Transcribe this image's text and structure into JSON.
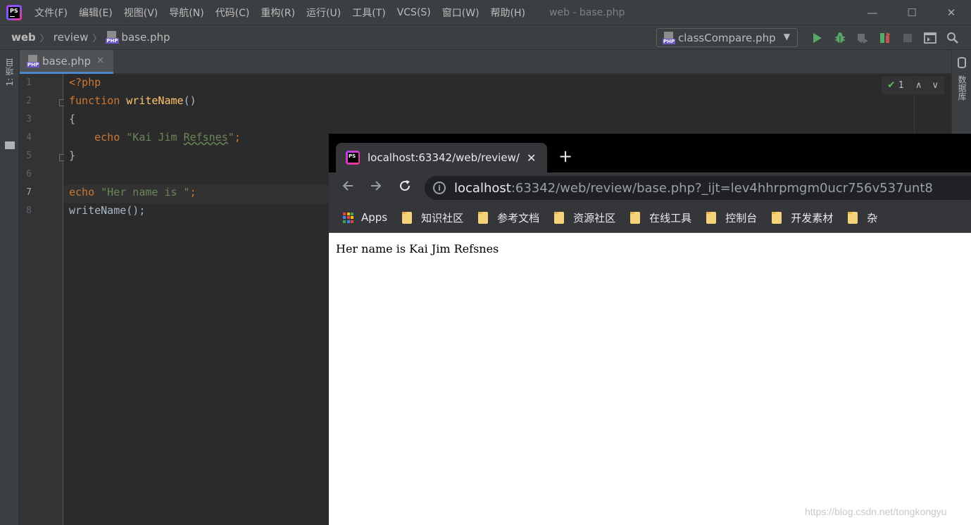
{
  "menubar": {
    "logo": "PS",
    "items": [
      "文件(F)",
      "编辑(E)",
      "视图(V)",
      "导航(N)",
      "代码(C)",
      "重构(R)",
      "运行(U)",
      "工具(T)",
      "VCS(S)",
      "窗口(W)",
      "帮助(H)"
    ],
    "window_title": "web - base.php",
    "controls": [
      "—",
      "☐",
      "✕"
    ]
  },
  "navbar": {
    "crumbs": [
      "web",
      "review",
      "base.php"
    ],
    "file_icon_label": "PHP",
    "run_config": "classCompare.php",
    "icons": [
      "play-icon",
      "debug-icon",
      "coverage-icon",
      "profiler-icon",
      "stop-icon",
      "terminal-icon",
      "search-icon"
    ],
    "colors": {
      "run": "#59a869",
      "bug": "#59a869"
    }
  },
  "left_strip": {
    "label": "1: 项目"
  },
  "right_strip": {
    "label": "数据库"
  },
  "tab": {
    "label": "base.php",
    "close": "✕"
  },
  "editor": {
    "line_numbers": [
      "1",
      "2",
      "3",
      "4",
      "5",
      "6",
      "7",
      "8"
    ],
    "current_line": "7",
    "lines": [
      {
        "tokens": [
          {
            "t": "<?php",
            "c": "kw"
          }
        ]
      },
      {
        "tokens": [
          {
            "t": "function",
            "c": "kw"
          },
          {
            "t": " ",
            "c": ""
          },
          {
            "t": "writeName",
            "c": "fn"
          },
          {
            "t": "()",
            "c": ""
          }
        ]
      },
      {
        "tokens": [
          {
            "t": "{",
            "c": ""
          }
        ]
      },
      {
        "tokens": [
          {
            "t": "    ",
            "c": ""
          },
          {
            "t": "echo",
            "c": "kw"
          },
          {
            "t": " ",
            "c": ""
          },
          {
            "t": "\"Kai Jim ",
            "c": "str"
          },
          {
            "t": "Refsnes",
            "c": "str squig"
          },
          {
            "t": "\"",
            "c": "str"
          },
          {
            "t": ";",
            "c": "kw"
          }
        ]
      },
      {
        "tokens": [
          {
            "t": "}",
            "c": ""
          }
        ]
      },
      {
        "tokens": []
      },
      {
        "tokens": [
          {
            "t": "echo",
            "c": "kw"
          },
          {
            "t": " ",
            "c": ""
          },
          {
            "t": "\"Her name is \"",
            "c": "str"
          },
          {
            "t": ";",
            "c": "kw"
          }
        ]
      },
      {
        "tokens": [
          {
            "t": "writeName();",
            "c": ""
          }
        ]
      }
    ],
    "inspection": {
      "count": "1",
      "up": "∧",
      "down": "∨"
    }
  },
  "browser": {
    "tab_title": "localhost:63342/web/review/base.php?_ijt=lev4hhrpmgm0ucr756v537unt8",
    "tab_close": "✕",
    "new_tab": "+",
    "url_host": "localhost",
    "url_rest": ":63342/web/review/base.php?_ijt=lev4hhrpmgm0ucr756v537unt8",
    "apps_label": "Apps",
    "bookmarks": [
      "知识社区",
      "参考文档",
      "资源社区",
      "在线工具",
      "控制台",
      "开发素材",
      "杂"
    ],
    "page_text": "Her name is Kai Jim Refsnes",
    "apps_colors": [
      "#ea4335",
      "#fbbc05",
      "#34a853",
      "#4285f4",
      "#ea4335",
      "#fbbc05",
      "#34a853",
      "#4285f4",
      "#ea4335"
    ]
  },
  "watermark": "https://blog.csdn.net/tongkongyu"
}
